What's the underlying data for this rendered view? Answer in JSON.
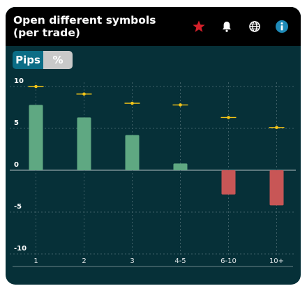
{
  "header": {
    "title": "Open different symbols\n(per trade)",
    "icons": [
      "star-icon",
      "bell-icon",
      "globe-icon",
      "info-icon"
    ]
  },
  "toggle": {
    "pips_label": "Pips",
    "percent_label": "%",
    "selected": "Pips"
  },
  "colors": {
    "positive_bar": "#5fa882",
    "negative_bar": "#c85656",
    "marker": "#f3c417",
    "star": "#d4202a",
    "info": "#1e8ab8"
  },
  "chart_data": {
    "type": "bar",
    "categories": [
      "1",
      "2",
      "3",
      "4-5",
      "6-10",
      "10+"
    ],
    "series": [
      {
        "values": [
          7.8,
          6.3,
          4.2,
          0.8,
          -2.9,
          -4.2
        ]
      },
      {
        "marker": "line-dot",
        "values": [
          10,
          9.1,
          8.0,
          7.8,
          6.3,
          5.1
        ]
      }
    ],
    "y_ticks": [
      10,
      5,
      0,
      -5,
      -10
    ],
    "ylim": [
      -10,
      10
    ],
    "grid": true
  }
}
